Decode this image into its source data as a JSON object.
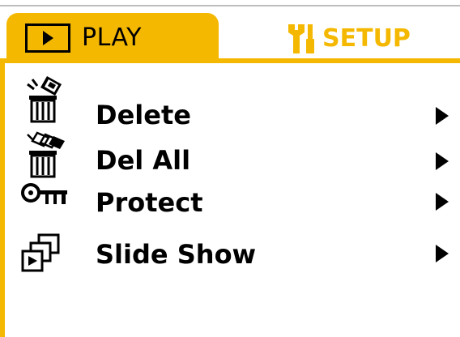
{
  "tabs": {
    "play": {
      "label": "PLAY",
      "icon": "play-icon",
      "active": true
    },
    "setup": {
      "label": "SETUP",
      "icon": "wrench-screwdriver-icon",
      "active": false
    }
  },
  "colors": {
    "accent": "#f5b800",
    "text": "#000000",
    "background": "#ffffff"
  },
  "menu": {
    "items": [
      {
        "label": "Delete",
        "icon": "trash-delete-icon"
      },
      {
        "label": "Del All",
        "icon": "trash-delete-all-icon"
      },
      {
        "label": "Protect",
        "icon": "key-protect-icon"
      },
      {
        "label": "Slide Show",
        "icon": "slideshow-icon"
      }
    ]
  }
}
